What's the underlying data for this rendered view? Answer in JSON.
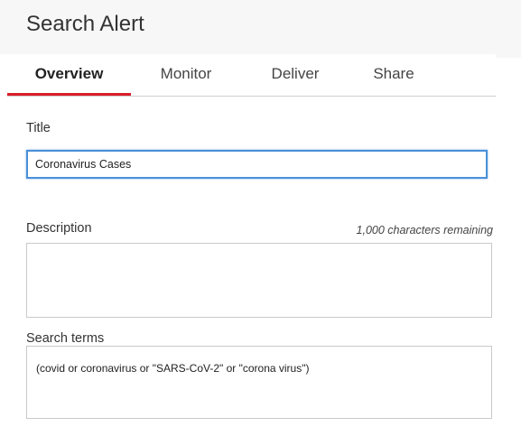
{
  "header": {
    "title": "Search Alert"
  },
  "tabs": [
    {
      "label": "Overview",
      "active": true
    },
    {
      "label": "Monitor",
      "active": false
    },
    {
      "label": "Deliver",
      "active": false
    },
    {
      "label": "Share",
      "active": false
    }
  ],
  "form": {
    "title_label": "Title",
    "title_value": "Coronavirus Cases",
    "description_label": "Description",
    "description_value": "",
    "characters_remaining": "1,000 characters remaining",
    "search_terms_label": "Search terms",
    "search_terms_value": "(covid or coronavirus or \"SARS-CoV-2\" or \"corona virus\")"
  },
  "colors": {
    "active_tab_underline": "#d81e2a",
    "focused_border": "#4a90d9",
    "header_background": "#f7f7f7"
  }
}
